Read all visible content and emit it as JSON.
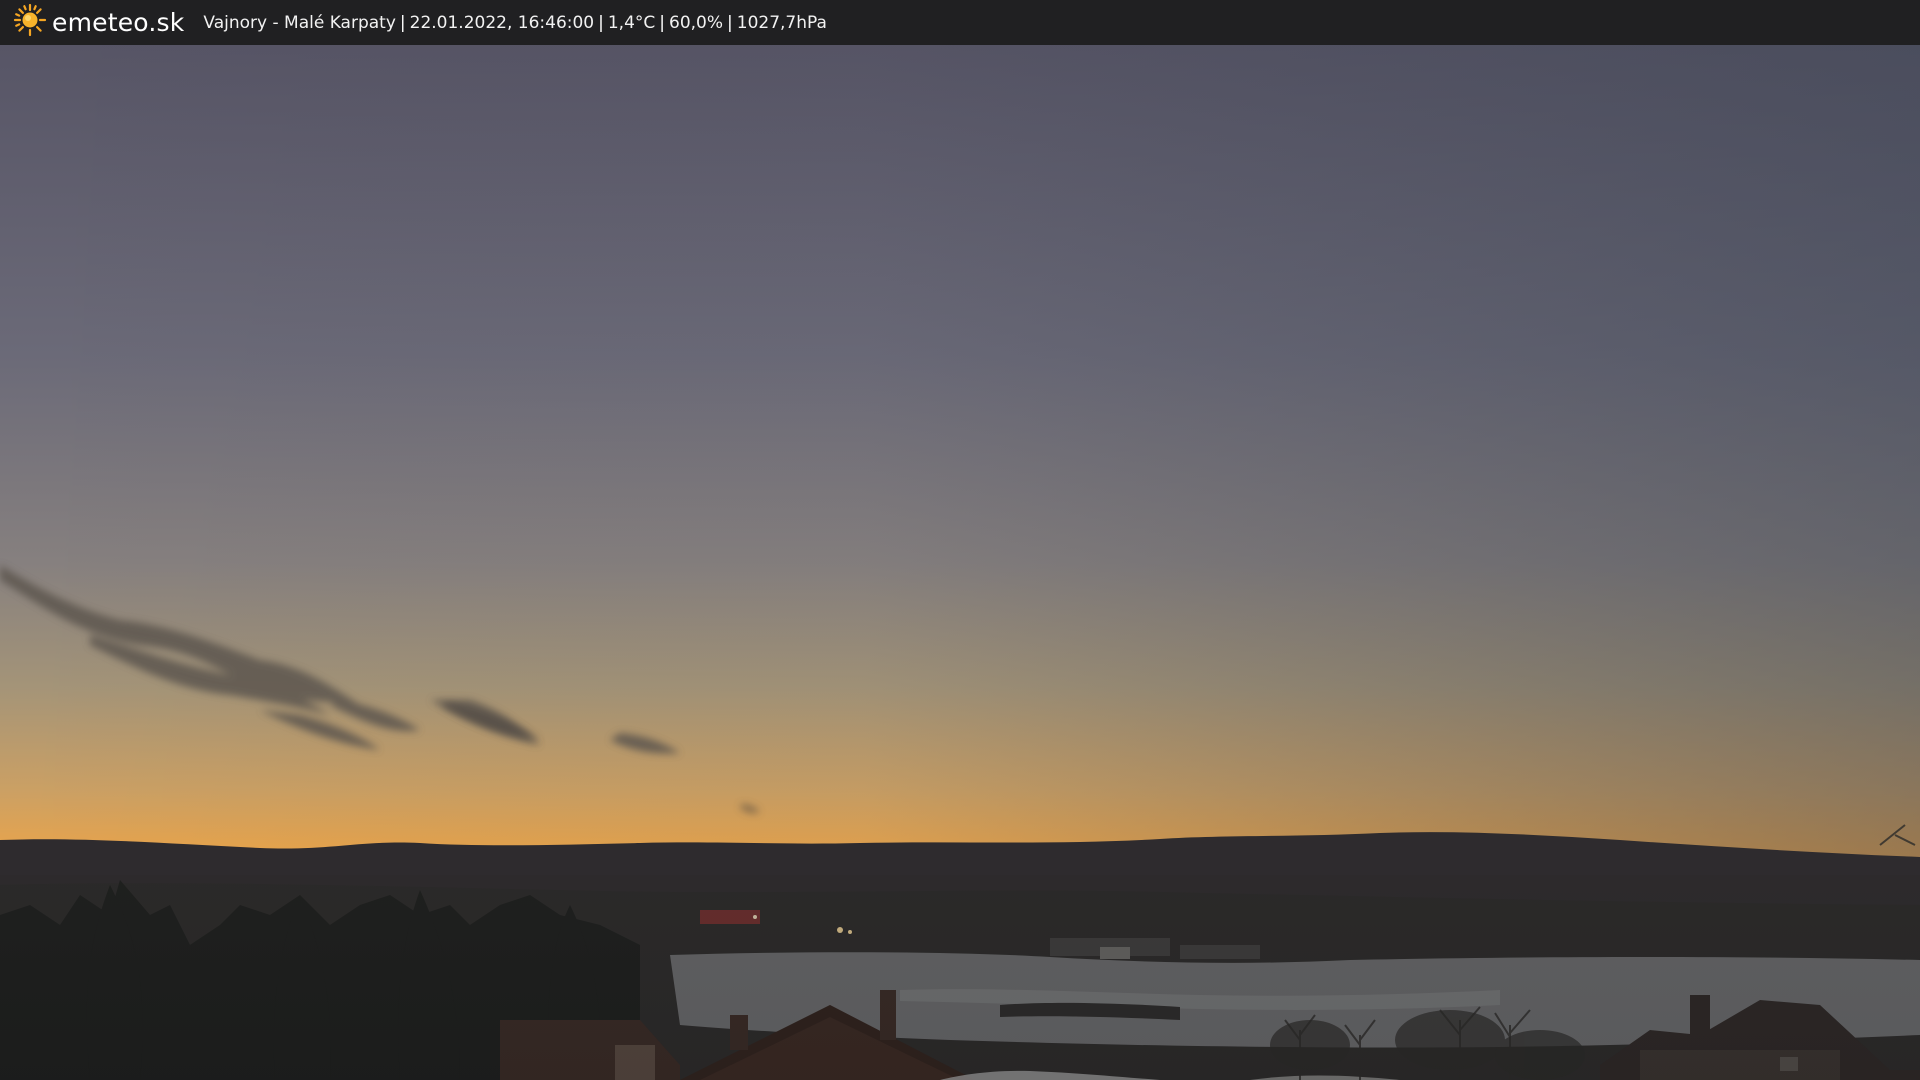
{
  "brand": {
    "name": "emeteo.sk",
    "icon": "sun-icon",
    "accent_color": "#f5a623"
  },
  "caption": {
    "location": "Vajnory - Malé Karpaty",
    "datetime": "22.01.2022, 16:46:00",
    "temperature": "1,4°C",
    "humidity": "60,0%",
    "pressure": "1027,7hPa",
    "separator": "|"
  },
  "scene": {
    "description_icon": "webcam-landscape-image",
    "sky_top_color": "#5a5868",
    "horizon_color": "#f0a84a"
  }
}
